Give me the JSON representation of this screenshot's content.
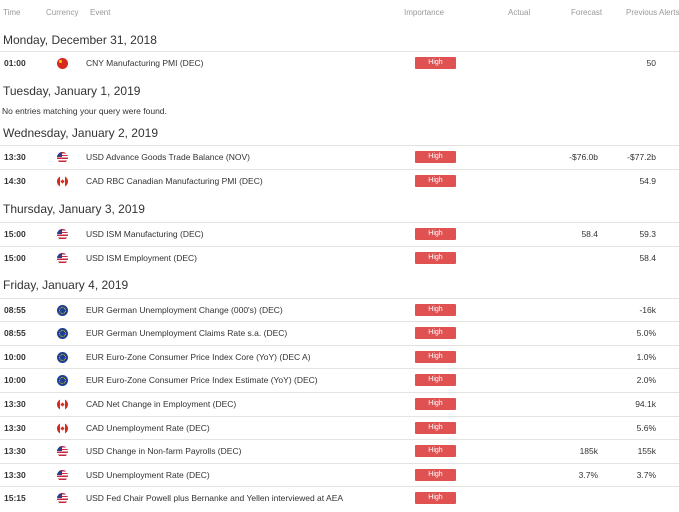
{
  "header": {
    "time": "Time",
    "currency": "Currency",
    "event": "Event",
    "importance": "Importance",
    "actual": "Actual",
    "forecast": "Forecast",
    "previous": "Previous",
    "alerts": "Alerts"
  },
  "days": [
    {
      "title": "Monday, December 31, 2018",
      "rows": [
        {
          "time": "01:00",
          "flag": "cn",
          "event": "CNY Manufacturing PMI (DEC)",
          "importance": "High",
          "actual": "",
          "forecast": "",
          "previous": "50"
        }
      ]
    },
    {
      "title": "Tuesday, January 1, 2019",
      "note": "No entries matching your query were found.",
      "rows": []
    },
    {
      "title": "Wednesday, January 2, 2019",
      "rows": [
        {
          "time": "13:30",
          "flag": "us",
          "event": "USD Advance Goods Trade Balance (NOV)",
          "importance": "High",
          "actual": "",
          "forecast": "-$76.0b",
          "previous": "-$77.2b"
        },
        {
          "time": "14:30",
          "flag": "ca",
          "event": "CAD RBC Canadian Manufacturing PMI (DEC)",
          "importance": "High",
          "actual": "",
          "forecast": "",
          "previous": "54.9"
        }
      ]
    },
    {
      "title": "Thursday, January 3, 2019",
      "rows": [
        {
          "time": "15:00",
          "flag": "us",
          "event": "USD ISM Manufacturing (DEC)",
          "importance": "High",
          "actual": "",
          "forecast": "58.4",
          "previous": "59.3"
        },
        {
          "time": "15:00",
          "flag": "us",
          "event": "USD ISM Employment (DEC)",
          "importance": "High",
          "actual": "",
          "forecast": "",
          "previous": "58.4"
        }
      ]
    },
    {
      "title": "Friday, January 4, 2019",
      "rows": [
        {
          "time": "08:55",
          "flag": "eu",
          "event": "EUR German Unemployment Change (000's) (DEC)",
          "importance": "High",
          "actual": "",
          "forecast": "",
          "previous": "-16k"
        },
        {
          "time": "08:55",
          "flag": "eu",
          "event": "EUR German Unemployment Claims Rate s.a. (DEC)",
          "importance": "High",
          "actual": "",
          "forecast": "",
          "previous": "5.0%"
        },
        {
          "time": "10:00",
          "flag": "eu",
          "event": "EUR Euro-Zone Consumer Price Index Core (YoY) (DEC A)",
          "importance": "High",
          "actual": "",
          "forecast": "",
          "previous": "1.0%"
        },
        {
          "time": "10:00",
          "flag": "eu",
          "event": "EUR Euro-Zone Consumer Price Index Estimate (YoY) (DEC)",
          "importance": "High",
          "actual": "",
          "forecast": "",
          "previous": "2.0%"
        },
        {
          "time": "13:30",
          "flag": "ca",
          "event": "CAD Net Change in Employment (DEC)",
          "importance": "High",
          "actual": "",
          "forecast": "",
          "previous": "94.1k"
        },
        {
          "time": "13:30",
          "flag": "ca",
          "event": "CAD Unemployment Rate (DEC)",
          "importance": "High",
          "actual": "",
          "forecast": "",
          "previous": "5.6%"
        },
        {
          "time": "13:30",
          "flag": "us",
          "event": "USD Change in Non-farm Payrolls (DEC)",
          "importance": "High",
          "actual": "",
          "forecast": "185k",
          "previous": "155k"
        },
        {
          "time": "13:30",
          "flag": "us",
          "event": "USD Unemployment Rate (DEC)",
          "importance": "High",
          "actual": "",
          "forecast": "3.7%",
          "previous": "3.7%"
        },
        {
          "time": "15:15",
          "flag": "us",
          "event": "USD Fed Chair Powell plus Bernanke and Yellen interviewed at AEA",
          "importance": "High",
          "actual": "",
          "forecast": "",
          "previous": ""
        }
      ]
    }
  ],
  "colors": {
    "importance_high": "#e05252",
    "divider": "#e3e3e3"
  }
}
